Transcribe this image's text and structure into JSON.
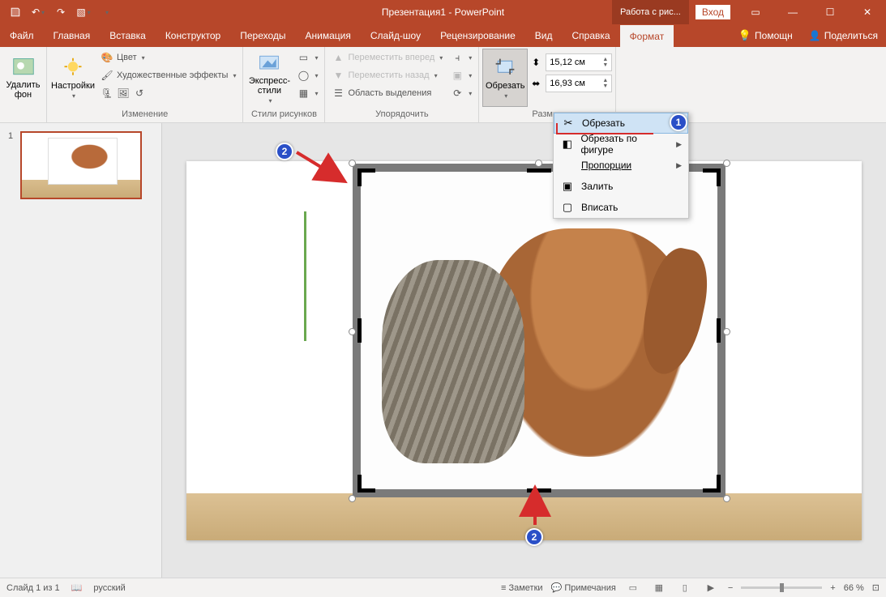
{
  "titlebar": {
    "title": "Презентация1 - PowerPoint",
    "contextual": "Работа с рис...",
    "login": "Вход"
  },
  "tabs": {
    "file": "Файл",
    "home": "Главная",
    "insert": "Вставка",
    "design": "Конструктор",
    "transitions": "Переходы",
    "animations": "Анимация",
    "slideshow": "Слайд-шоу",
    "review": "Рецензирование",
    "view": "Вид",
    "help": "Справка",
    "format": "Формат",
    "tell_me": "Помощн",
    "share": "Поделиться"
  },
  "ribbon": {
    "remove_bg": "Удалить фон",
    "corrections": "Настройки",
    "color": "Цвет",
    "artistic": "Художественные эффекты",
    "group_adjust": "Изменение",
    "express_styles": "Экспресс-стили",
    "group_styles": "Стили рисунков",
    "bring_forward": "Переместить вперед",
    "send_backward": "Переместить назад",
    "selection_pane": "Область выделения",
    "group_arrange": "Упорядочить",
    "crop": "Обрезать",
    "height": "15,12 см",
    "width": "16,93 см",
    "group_size": "Размер"
  },
  "crop_menu": {
    "crop": "Обрезать",
    "crop_to_shape": "Обрезать по фигуре",
    "aspect_ratio": "Пропорции",
    "fill": "Залить",
    "fit": "Вписать"
  },
  "thumb": {
    "num": "1"
  },
  "annotations": {
    "b1": "1",
    "b2": "2"
  },
  "status": {
    "slide_of": "Слайд 1 из 1",
    "lang": "русский",
    "notes": "Заметки",
    "comments": "Примечания",
    "zoom": "66 %"
  }
}
